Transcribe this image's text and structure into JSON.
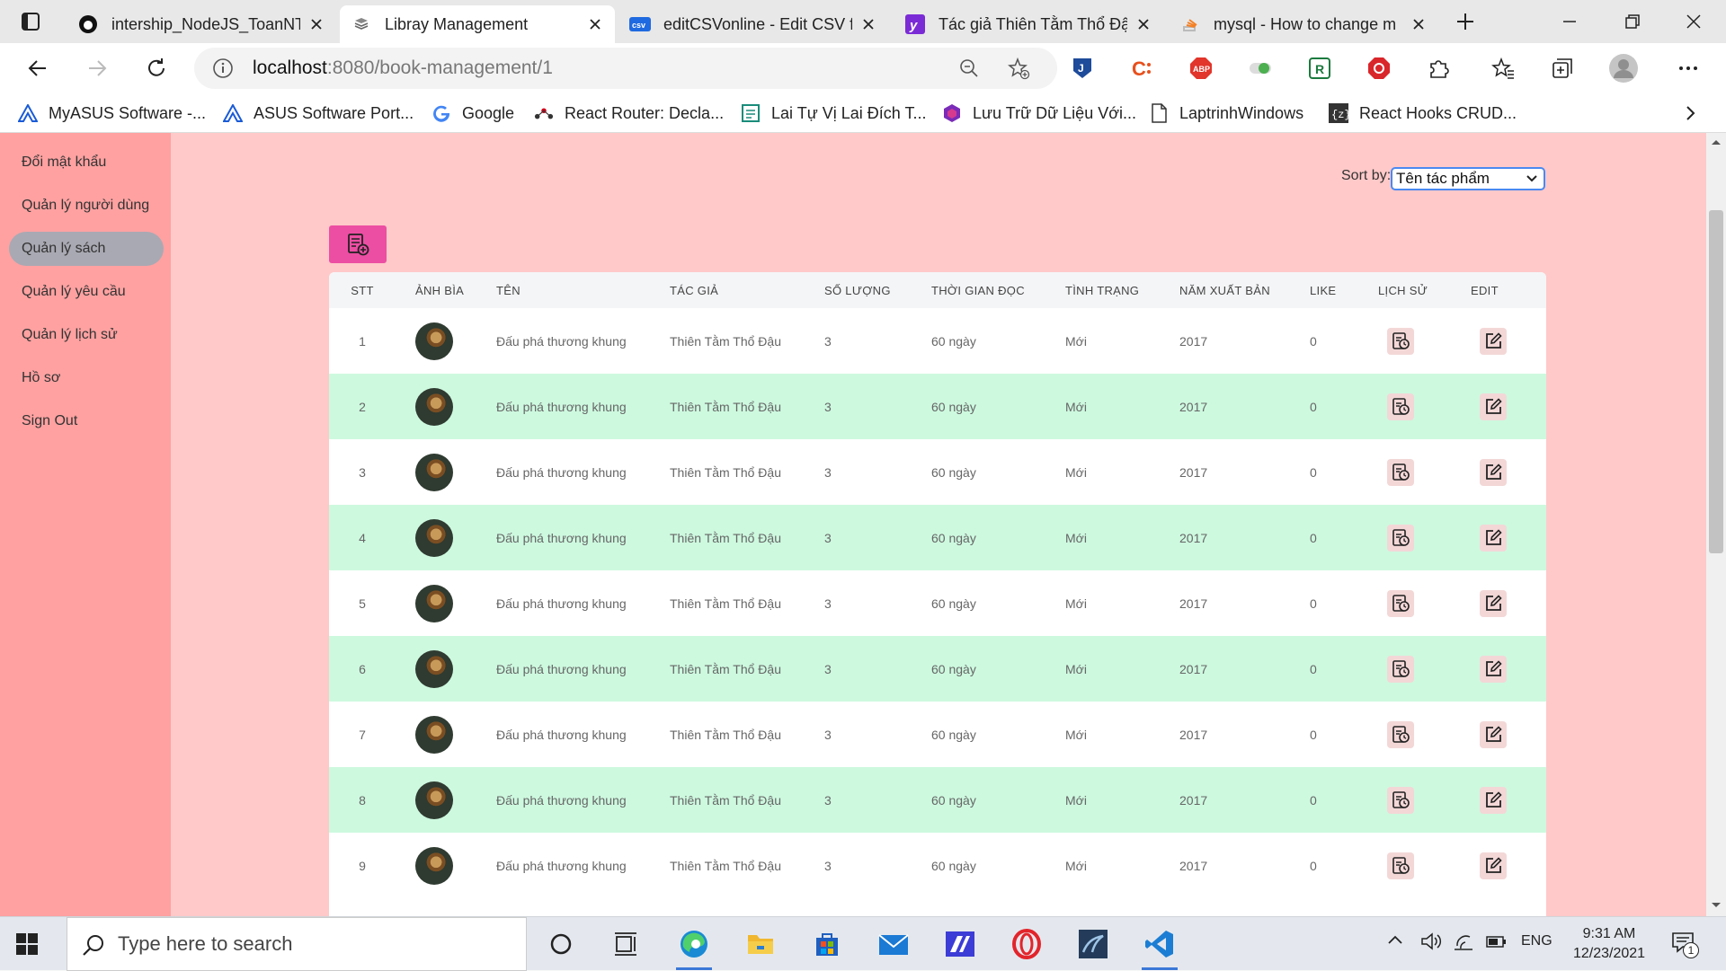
{
  "browser": {
    "tabs": [
      {
        "title": "intership_NodeJS_ToanNT",
        "icon": "github-icon",
        "active": false
      },
      {
        "title": "Libray Management",
        "icon": "book-icon",
        "active": true
      },
      {
        "title": "editCSVonline - Edit CSV f",
        "icon": "csv-icon",
        "active": false
      },
      {
        "title": "Tác giả Thiên Tằm Thổ Đậ",
        "icon": "y-icon",
        "active": false
      },
      {
        "title": "mysql - How to change m",
        "icon": "stackoverflow-icon",
        "active": false
      }
    ],
    "address": {
      "host": "localhost",
      "path": ":8080/book-management/1"
    },
    "bookmarks": [
      {
        "label": "MyASUS Software -...",
        "icon": "asus-icon"
      },
      {
        "label": "ASUS Software Port...",
        "icon": "asus-icon"
      },
      {
        "label": "Google",
        "icon": "google-icon"
      },
      {
        "label": "React Router: Decla...",
        "icon": "react-router-icon"
      },
      {
        "label": "Lai Tự Vị Lai Đích T...",
        "icon": "doc-icon"
      },
      {
        "label": "Lưu Trữ Dữ Liệu Với...",
        "icon": "hexagon-icon"
      },
      {
        "label": "LaptrinhWindows",
        "icon": "page-icon"
      },
      {
        "label": "React Hooks CRUD...",
        "icon": "bracket-icon"
      }
    ]
  },
  "sidebar": {
    "items": [
      {
        "label": "Đổi mật khẩu",
        "active": false
      },
      {
        "label": "Quản lý người dùng",
        "active": false
      },
      {
        "label": "Quản lý sách",
        "active": true
      },
      {
        "label": "Quản lý yêu cầu",
        "active": false
      },
      {
        "label": "Quản lý lịch sử",
        "active": false
      },
      {
        "label": "Hồ sơ",
        "active": false
      },
      {
        "label": "Sign Out",
        "active": false
      }
    ]
  },
  "sort": {
    "label": "Sort by:",
    "selected": "Tên tác phẩm"
  },
  "table": {
    "headers": [
      "STT",
      "ẢNH BÌA",
      "TÊN",
      "TÁC GIẢ",
      "SỐ LƯỢNG",
      "THỜI GIAN ĐỌC",
      "TÌNH TRẠNG",
      "NĂM XUẤT BẢN",
      "LIKE",
      "LỊCH SỬ",
      "EDIT"
    ],
    "rows": [
      {
        "stt": "1",
        "name": "Đấu phá thương khung",
        "author": "Thiên Tằm Thổ Đậu",
        "qty": "3",
        "time": "60 ngày",
        "status": "Mới",
        "year": "2017",
        "like": "0"
      },
      {
        "stt": "2",
        "name": "Đấu phá thương khung",
        "author": "Thiên Tằm Thổ Đậu",
        "qty": "3",
        "time": "60 ngày",
        "status": "Mới",
        "year": "2017",
        "like": "0"
      },
      {
        "stt": "3",
        "name": "Đấu phá thương khung",
        "author": "Thiên Tằm Thổ Đậu",
        "qty": "3",
        "time": "60 ngày",
        "status": "Mới",
        "year": "2017",
        "like": "0"
      },
      {
        "stt": "4",
        "name": "Đấu phá thương khung",
        "author": "Thiên Tằm Thổ Đậu",
        "qty": "3",
        "time": "60 ngày",
        "status": "Mới",
        "year": "2017",
        "like": "0"
      },
      {
        "stt": "5",
        "name": "Đấu phá thương khung",
        "author": "Thiên Tằm Thổ Đậu",
        "qty": "3",
        "time": "60 ngày",
        "status": "Mới",
        "year": "2017",
        "like": "0"
      },
      {
        "stt": "6",
        "name": "Đấu phá thương khung",
        "author": "Thiên Tằm Thổ Đậu",
        "qty": "3",
        "time": "60 ngày",
        "status": "Mới",
        "year": "2017",
        "like": "0"
      },
      {
        "stt": "7",
        "name": "Đấu phá thương khung",
        "author": "Thiên Tằm Thổ Đậu",
        "qty": "3",
        "time": "60 ngày",
        "status": "Mới",
        "year": "2017",
        "like": "0"
      },
      {
        "stt": "8",
        "name": "Đấu phá thương khung",
        "author": "Thiên Tằm Thổ Đậu",
        "qty": "3",
        "time": "60 ngày",
        "status": "Mới",
        "year": "2017",
        "like": "0"
      },
      {
        "stt": "9",
        "name": "Đấu phá thương khung",
        "author": "Thiên Tằm Thổ Đậu",
        "qty": "3",
        "time": "60 ngày",
        "status": "Mới",
        "year": "2017",
        "like": "0"
      }
    ]
  },
  "taskbar": {
    "search_placeholder": "Type here to search",
    "language": "ENG",
    "time": "9:31 AM",
    "date": "12/23/2021",
    "notification_count": "1"
  },
  "colors": {
    "page_bg": "#ffc9c9",
    "sidebar_bg": "#ffa1a1",
    "add_button": "#ec4ea3",
    "row_alt": "#cdf9df",
    "active_nav": "#a9a9b3"
  }
}
